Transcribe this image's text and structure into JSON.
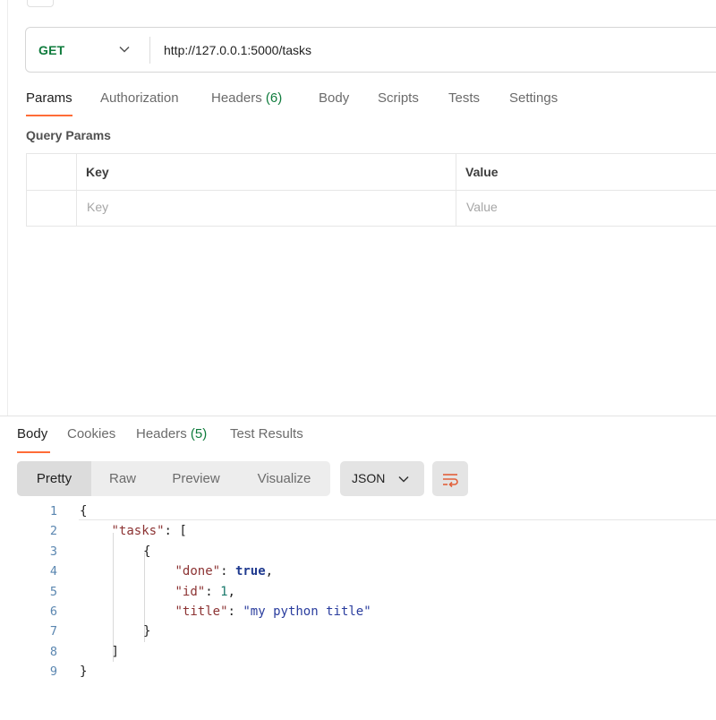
{
  "request": {
    "method": "GET",
    "url": "http://127.0.0.1:5000/tasks"
  },
  "request_tabs": [
    {
      "label": "Params",
      "count": ""
    },
    {
      "label": "Authorization",
      "count": ""
    },
    {
      "label": "Headers",
      "count": "(6)"
    },
    {
      "label": "Body",
      "count": ""
    },
    {
      "label": "Scripts",
      "count": ""
    },
    {
      "label": "Tests",
      "count": ""
    },
    {
      "label": "Settings",
      "count": ""
    }
  ],
  "query_params": {
    "title": "Query Params",
    "columns": [
      "Key",
      "Value"
    ],
    "placeholders": [
      "Key",
      "Value"
    ]
  },
  "response_tabs": [
    {
      "label": "Body",
      "count": ""
    },
    {
      "label": "Cookies",
      "count": ""
    },
    {
      "label": "Headers",
      "count": "(5)"
    },
    {
      "label": "Test Results",
      "count": ""
    }
  ],
  "view_modes": [
    "Pretty",
    "Raw",
    "Preview",
    "Visualize"
  ],
  "format": "JSON",
  "code_lines": [
    {
      "n": "1",
      "indent": 0,
      "parts": [
        [
          "p",
          "{"
        ]
      ]
    },
    {
      "n": "2",
      "indent": 1,
      "parts": [
        [
          "key",
          "\"tasks\""
        ],
        [
          "p",
          ": ["
        ]
      ]
    },
    {
      "n": "3",
      "indent": 2,
      "parts": [
        [
          "p",
          "{"
        ]
      ]
    },
    {
      "n": "4",
      "indent": 3,
      "parts": [
        [
          "key",
          "\"done\""
        ],
        [
          "p",
          ": "
        ],
        [
          "bool",
          "true"
        ],
        [
          "p",
          ","
        ]
      ]
    },
    {
      "n": "5",
      "indent": 3,
      "parts": [
        [
          "key",
          "\"id\""
        ],
        [
          "p",
          ": "
        ],
        [
          "num",
          "1"
        ],
        [
          "p",
          ","
        ]
      ]
    },
    {
      "n": "6",
      "indent": 3,
      "parts": [
        [
          "key",
          "\"title\""
        ],
        [
          "p",
          ": "
        ],
        [
          "str",
          "\"my python title\""
        ]
      ]
    },
    {
      "n": "7",
      "indent": 2,
      "parts": [
        [
          "p",
          "}"
        ]
      ]
    },
    {
      "n": "8",
      "indent": 1,
      "parts": [
        [
          "p",
          "]"
        ]
      ]
    },
    {
      "n": "9",
      "indent": 0,
      "parts": [
        [
          "p",
          "}"
        ]
      ]
    }
  ],
  "colors": {
    "accent": "#ff6c37",
    "method_get": "#0f7b3c",
    "count": "#0f7b3c",
    "json_key": "#8c3333",
    "json_string": "#2a3d9e",
    "json_bool": "#1f3a8f",
    "json_number": "#1a7a6c"
  },
  "icons": {
    "method_dropdown": "chevron-down-icon",
    "format_dropdown": "chevron-down-icon",
    "wrap": "wrap-lines-icon"
  }
}
